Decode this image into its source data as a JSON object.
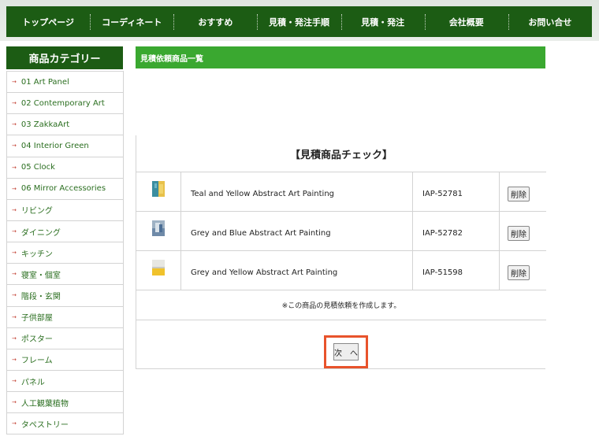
{
  "nav": {
    "items": [
      "トップページ",
      "コーディネート",
      "おすすめ",
      "見積・発注手順",
      "見積・発注",
      "会社概要",
      "お問い合せ"
    ]
  },
  "sidebar": {
    "title": "商品カテゴリー",
    "items": [
      "01 Art Panel",
      "02 Contemporary Art",
      "03 ZakkaArt",
      "04 Interior Green",
      "05 Clock",
      "06 Mirror Accessories",
      "リビング",
      "ダイニング",
      "キッチン",
      "寝室・個室",
      "階段・玄関",
      "子供部屋",
      "ポスター",
      "フレーム",
      "パネル",
      "人工観葉植物",
      "タペストリー"
    ]
  },
  "main": {
    "section_title": "見積依頼商品一覧",
    "check_title": "【見積商品チェック】",
    "items": [
      {
        "name": "Teal and Yellow Abstract Art Painting",
        "code": "IAP-52781",
        "delete_label": "削除",
        "thumb_icon": "teal-yellow-painting-thumbnail"
      },
      {
        "name": "Grey and Blue Abstract Art Painting",
        "code": "IAP-52782",
        "delete_label": "削除",
        "thumb_icon": "grey-blue-painting-thumbnail"
      },
      {
        "name": "Grey and Yellow Abstract Art Painting",
        "code": "IAP-51598",
        "delete_label": "削除",
        "thumb_icon": "grey-yellow-painting-thumbnail"
      }
    ],
    "note": "※この商品の見積依頼を作成します。",
    "next_label": "次　へ"
  },
  "colors": {
    "nav_bg": "#1c5c14",
    "section_bar": "#3aa830",
    "link_green": "#2a6e1f",
    "highlight_border": "#e8532b"
  }
}
